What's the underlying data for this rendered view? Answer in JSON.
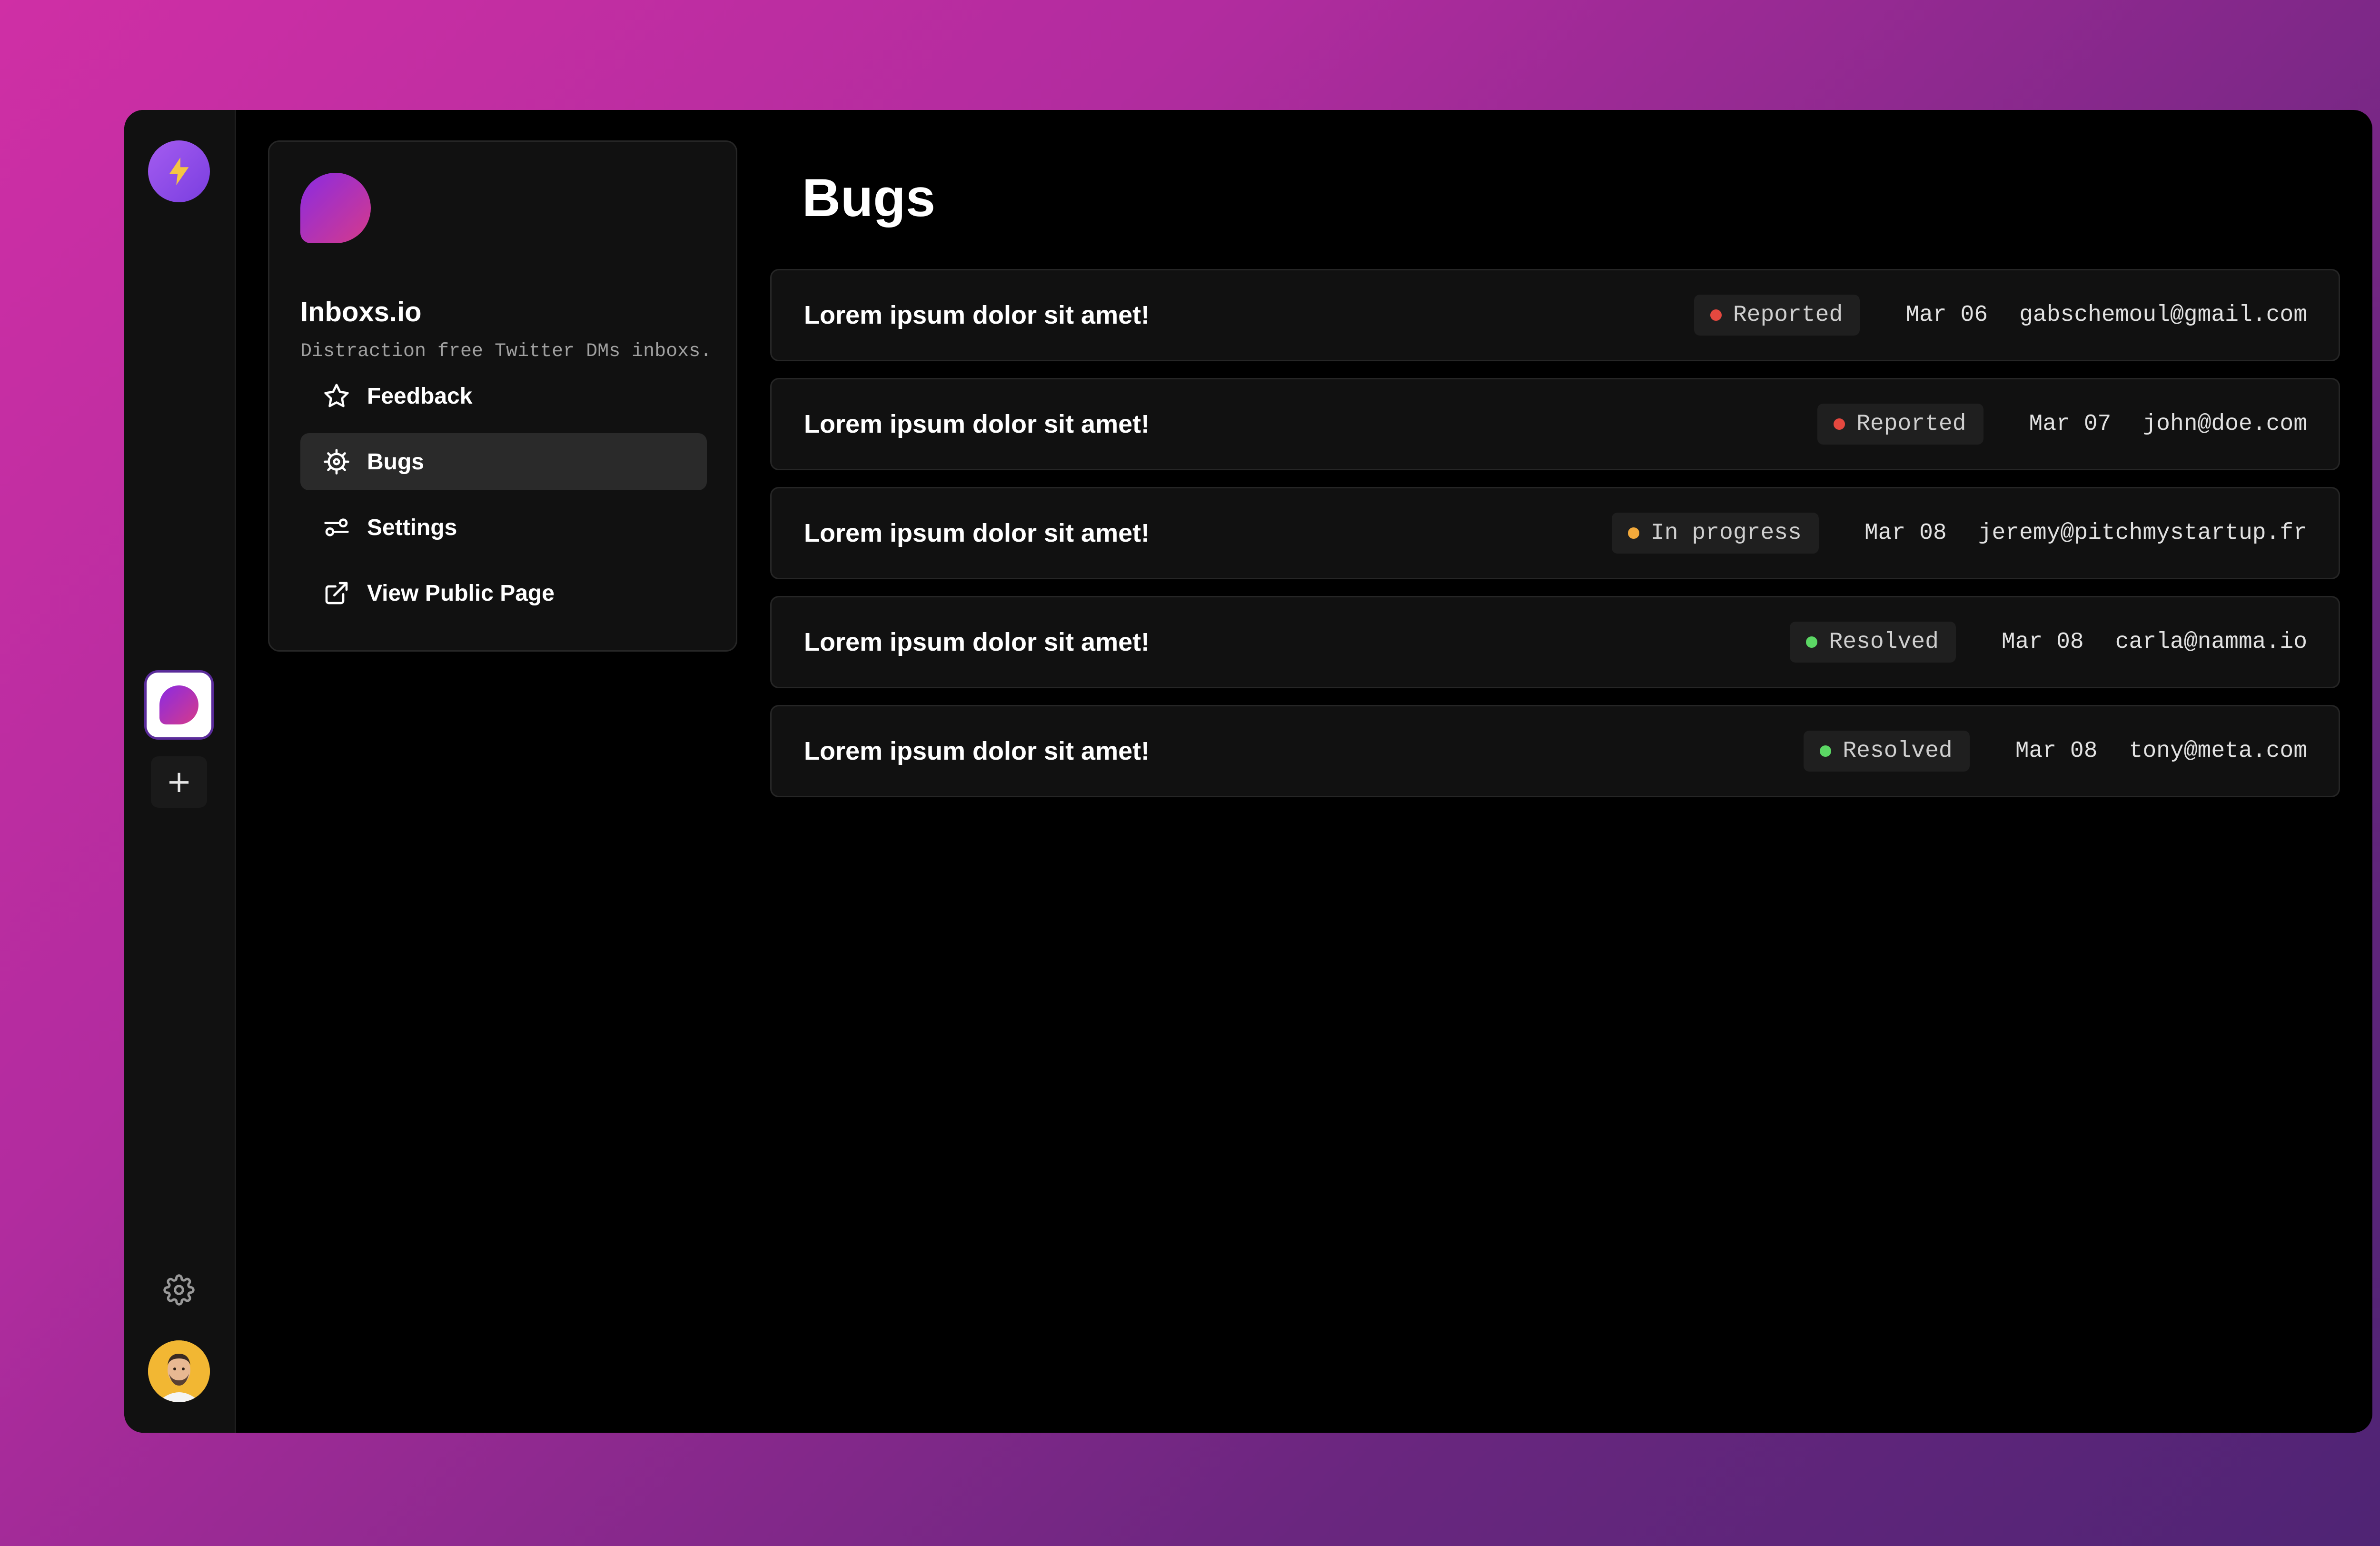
{
  "colors": {
    "accent_purple": "#8a2be2",
    "accent_pink": "#d63a8a",
    "reported": "#e5483f",
    "in_progress": "#f2a93b",
    "resolved": "#5bd764"
  },
  "rail": {
    "logo_icon": "lightning-icon",
    "add_label": "+",
    "settings_icon": "gear-icon",
    "avatar_icon": "user-avatar"
  },
  "project": {
    "name": "Inboxs.io",
    "description": "Distraction free Twitter DMs inboxs."
  },
  "nav": [
    {
      "label": "Feedback",
      "icon": "star-icon"
    },
    {
      "label": "Bugs",
      "icon": "bug-icon",
      "active": true
    },
    {
      "label": "Settings",
      "icon": "sliders-icon"
    },
    {
      "label": "View Public Page",
      "icon": "external-link-icon"
    }
  ],
  "main": {
    "title": "Bugs"
  },
  "bugs": [
    {
      "title": "Lorem ipsum dolor sit amet!",
      "status": "Reported",
      "status_color": "#e5483f",
      "date": "Mar 06",
      "email": "gabschemoul@gmail.com"
    },
    {
      "title": "Lorem ipsum dolor sit amet!",
      "status": "Reported",
      "status_color": "#e5483f",
      "date": "Mar 07",
      "email": "john@doe.com"
    },
    {
      "title": "Lorem ipsum dolor sit amet!",
      "status": "In progress",
      "status_color": "#f2a93b",
      "date": "Mar 08",
      "email": "jeremy@pitchmystartup.fr"
    },
    {
      "title": "Lorem ipsum dolor sit amet!",
      "status": "Resolved",
      "status_color": "#5bd764",
      "date": "Mar 08",
      "email": "carla@namma.io"
    },
    {
      "title": "Lorem ipsum dolor sit amet!",
      "status": "Resolved",
      "status_color": "#5bd764",
      "date": "Mar 08",
      "email": "tony@meta.com"
    }
  ]
}
